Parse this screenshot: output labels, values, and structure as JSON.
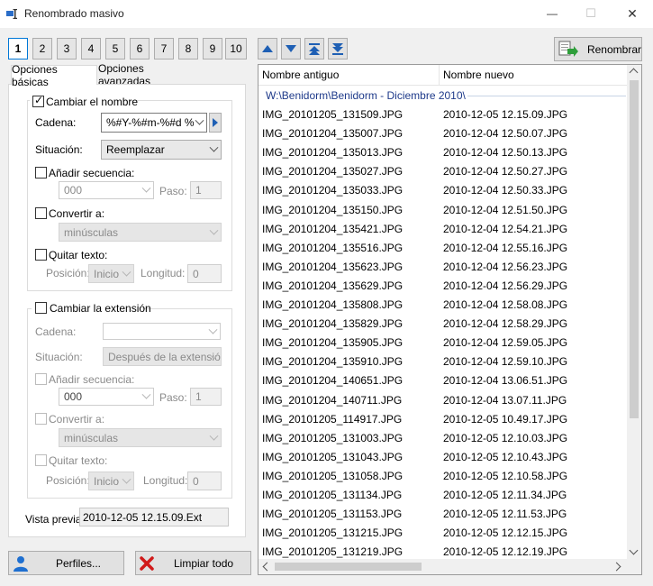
{
  "window": {
    "title": "Renombrado masivo",
    "minimize": "—",
    "maximize": "☐",
    "close": "✕"
  },
  "profiles": [
    "1",
    "2",
    "3",
    "4",
    "5",
    "6",
    "7",
    "8",
    "9",
    "10"
  ],
  "nav_icons": [
    "arrow-up-icon",
    "arrow-down-icon",
    "move-top-icon",
    "move-bottom-icon"
  ],
  "rename_button": "Renombrar",
  "tabs": {
    "basic": "Opciones básicas",
    "advanced": "Opciones avanzadas"
  },
  "name_group": {
    "checkbox_label": "Cambiar el nombre",
    "checked": true,
    "cadena_label": "Cadena:",
    "cadena_value": "%#Y-%#m-%#d %",
    "situacion_label": "Situación:",
    "situacion_value": "Reemplazar",
    "secuencia_label": "Añadir secuencia:",
    "secuencia_value": "000",
    "paso_label": "Paso:",
    "paso_value": "1",
    "convertir_label": "Convertir a:",
    "convertir_value": "minúsculas",
    "quitar_label": "Quitar texto:",
    "posicion_label": "Posición:",
    "posicion_value": "Inicio",
    "longitud_label": "Longitud:",
    "longitud_value": "0"
  },
  "ext_group": {
    "checkbox_label": "Cambiar la extensión",
    "checked": false,
    "cadena_label": "Cadena:",
    "cadena_value": "",
    "situacion_label": "Situación:",
    "situacion_value": "Después de la extensión",
    "secuencia_label": "Añadir secuencia:",
    "secuencia_value": "000",
    "paso_label": "Paso:",
    "paso_value": "1",
    "convertir_label": "Convertir a:",
    "convertir_value": "minúsculas",
    "quitar_label": "Quitar texto:",
    "posicion_label": "Posición:",
    "posicion_value": "Inicio",
    "longitud_label": "Longitud:",
    "longitud_value": "0"
  },
  "preview": {
    "label": "Vista previa:",
    "value": "2010-12-05 12.15.09.Ext"
  },
  "buttons": {
    "profiles": "Perfiles...",
    "clear": "Limpiar todo"
  },
  "list": {
    "col_old": "Nombre antiguo",
    "col_new": "Nombre nuevo",
    "group": "W:\\Benidorm\\Benidorm - Diciembre 2010\\",
    "rows": [
      [
        "IMG_20101205_131509.JPG",
        "2010-12-05 12.15.09.JPG"
      ],
      [
        "IMG_20101204_135007.JPG",
        "2010-12-04 12.50.07.JPG"
      ],
      [
        "IMG_20101204_135013.JPG",
        "2010-12-04 12.50.13.JPG"
      ],
      [
        "IMG_20101204_135027.JPG",
        "2010-12-04 12.50.27.JPG"
      ],
      [
        "IMG_20101204_135033.JPG",
        "2010-12-04 12.50.33.JPG"
      ],
      [
        "IMG_20101204_135150.JPG",
        "2010-12-04 12.51.50.JPG"
      ],
      [
        "IMG_20101204_135421.JPG",
        "2010-12-04 12.54.21.JPG"
      ],
      [
        "IMG_20101204_135516.JPG",
        "2010-12-04 12.55.16.JPG"
      ],
      [
        "IMG_20101204_135623.JPG",
        "2010-12-04 12.56.23.JPG"
      ],
      [
        "IMG_20101204_135629.JPG",
        "2010-12-04 12.56.29.JPG"
      ],
      [
        "IMG_20101204_135808.JPG",
        "2010-12-04 12.58.08.JPG"
      ],
      [
        "IMG_20101204_135829.JPG",
        "2010-12-04 12.58.29.JPG"
      ],
      [
        "IMG_20101204_135905.JPG",
        "2010-12-04 12.59.05.JPG"
      ],
      [
        "IMG_20101204_135910.JPG",
        "2010-12-04 12.59.10.JPG"
      ],
      [
        "IMG_20101204_140651.JPG",
        "2010-12-04 13.06.51.JPG"
      ],
      [
        "IMG_20101204_140711.JPG",
        "2010-12-04 13.07.11.JPG"
      ],
      [
        "IMG_20101205_114917.JPG",
        "2010-12-05 10.49.17.JPG"
      ],
      [
        "IMG_20101205_131003.JPG",
        "2010-12-05 12.10.03.JPG"
      ],
      [
        "IMG_20101205_131043.JPG",
        "2010-12-05 12.10.43.JPG"
      ],
      [
        "IMG_20101205_131058.JPG",
        "2010-12-05 12.10.58.JPG"
      ],
      [
        "IMG_20101205_131134.JPG",
        "2010-12-05 12.11.34.JPG"
      ],
      [
        "IMG_20101205_131153.JPG",
        "2010-12-05 12.11.53.JPG"
      ],
      [
        "IMG_20101205_131215.JPG",
        "2010-12-05 12.12.15.JPG"
      ],
      [
        "IMG_20101205_131219.JPG",
        "2010-12-05 12.12.19.JPG"
      ]
    ]
  },
  "colors": {
    "accent": "#0078d7",
    "group_text": "#1e3a8a",
    "nav_blue": "#1e5fb4",
    "clear_red": "#d11a1a"
  }
}
